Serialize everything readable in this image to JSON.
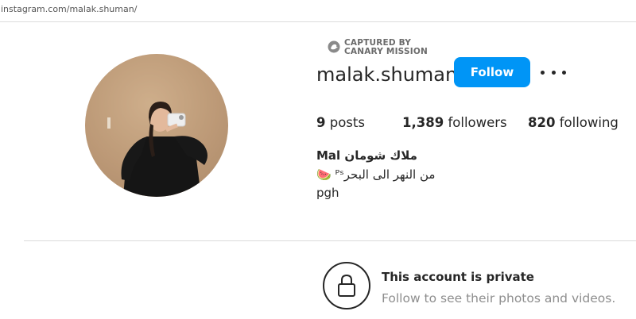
{
  "browser": {
    "url": "instagram.com/malak.shuman/"
  },
  "watermark": {
    "line1": "CAPTURED BY",
    "line2": "CANARY MISSION"
  },
  "profile": {
    "username": "malak.shuman",
    "follow_label": "Follow",
    "more_icon": "more-options-icon",
    "stats": {
      "posts_count": "9",
      "posts_label": "posts",
      "followers_count": "1,389",
      "followers_label": "followers",
      "following_count": "820",
      "following_label": "following"
    },
    "full_name": "Mal ملاك شومان",
    "bio_line1": "🍉 ᴾˢمن النهر الى البحر",
    "bio_line2": "pgh"
  },
  "private_notice": {
    "icon": "lock-icon",
    "title": "This account is private",
    "subtitle": "Follow to see their photos and videos."
  },
  "colors": {
    "accent": "#0095f6",
    "text": "#262626",
    "muted": "#8e8e8e",
    "divider": "#dbdbdb"
  }
}
